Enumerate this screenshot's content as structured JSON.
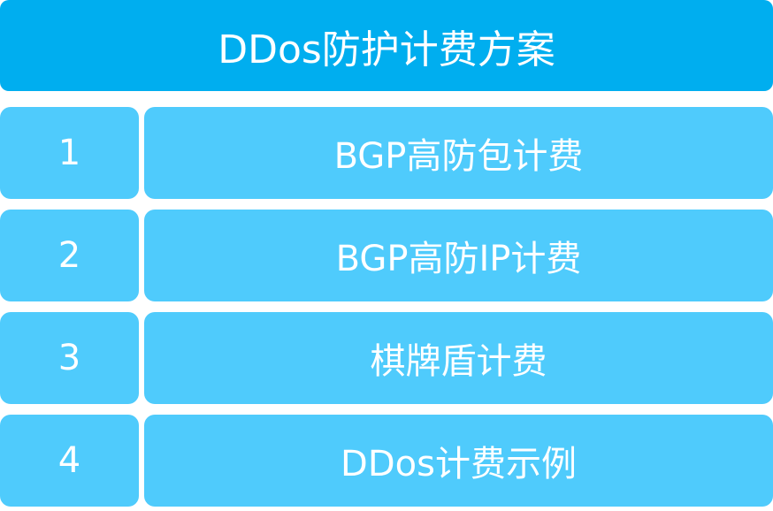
{
  "title": "DDos防护计费方案",
  "items": [
    {
      "number": "1",
      "label": "BGP高防包计费"
    },
    {
      "number": "2",
      "label": "BGP高防IP计费"
    },
    {
      "number": "3",
      "label": "棋牌盾计费"
    },
    {
      "number": "4",
      "label": "DDos计费示例"
    }
  ],
  "colors": {
    "header": "#00aeef",
    "row": "#4fcbfc",
    "text": "#ffffff"
  }
}
